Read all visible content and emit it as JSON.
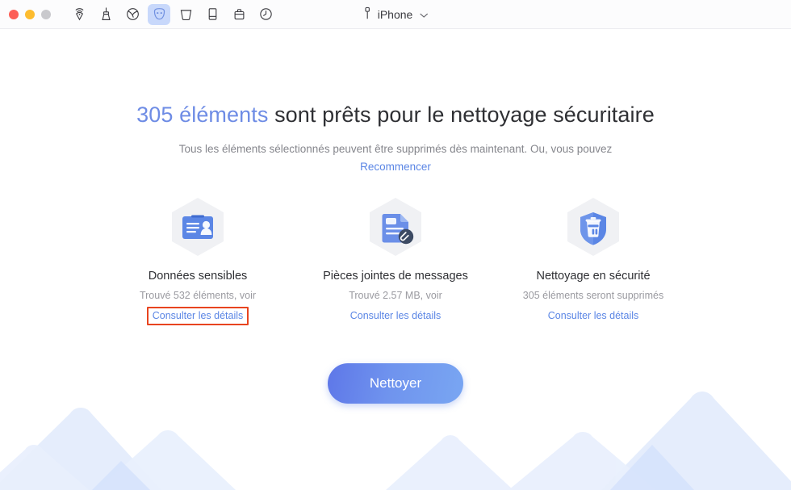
{
  "window": {
    "traffic_lights": [
      "close",
      "minimize",
      "maximize"
    ],
    "toolbar_icons": [
      {
        "name": "airdrop-icon",
        "label": "AirDrop",
        "active": false
      },
      {
        "name": "broom-icon",
        "label": "Nettoyer",
        "active": false
      },
      {
        "name": "globe-icon",
        "label": "Navigateur",
        "active": false
      },
      {
        "name": "privacy-mask-icon",
        "label": "Confidentialité",
        "active": true
      },
      {
        "name": "trash-bin-icon",
        "label": "Corbeille",
        "active": false
      },
      {
        "name": "book-icon",
        "label": "Livres",
        "active": false
      },
      {
        "name": "briefcase-icon",
        "label": "Outils",
        "active": false
      },
      {
        "name": "history-clock-icon",
        "label": "Historique",
        "active": false
      }
    ],
    "device": {
      "icon": "lightning-connector-icon",
      "name": "iPhone",
      "chevron": "chevron-down-icon"
    }
  },
  "main": {
    "headline": {
      "count": "305 éléments",
      "rest": " sont prêts pour le nettoyage sécuritaire"
    },
    "subline": "Tous les éléments sélectionnés peuvent être supprimés dès maintenant. Ou, vous pouvez",
    "restart_link": "Recommencer",
    "cards": [
      {
        "icon": "id-card-icon",
        "title": "Données sensibles",
        "subtitle": "Trouvé 532 éléments, voir",
        "link": "Consulter les détails",
        "highlighted": true
      },
      {
        "icon": "document-attachment-icon",
        "title": "Pièces jointes de messages",
        "subtitle": "Trouvé 2.57 MB, voir",
        "link": "Consulter les détails",
        "highlighted": false
      },
      {
        "icon": "shield-trash-icon",
        "title": "Nettoyage en sécurité",
        "subtitle": "305 éléments seront supprimés",
        "link": "Consulter les détails",
        "highlighted": false
      }
    ],
    "cta_label": "Nettoyer"
  },
  "colors": {
    "accent_blue": "#5b86e5",
    "headline_count": "#6e8ce5",
    "highlight_border": "#e8441f",
    "cta_gradient_start": "#5e77e8",
    "cta_gradient_end": "#79a6f2",
    "mountain_fill": "#dfe8fb",
    "active_tool_bg": "#c8d8fb"
  }
}
